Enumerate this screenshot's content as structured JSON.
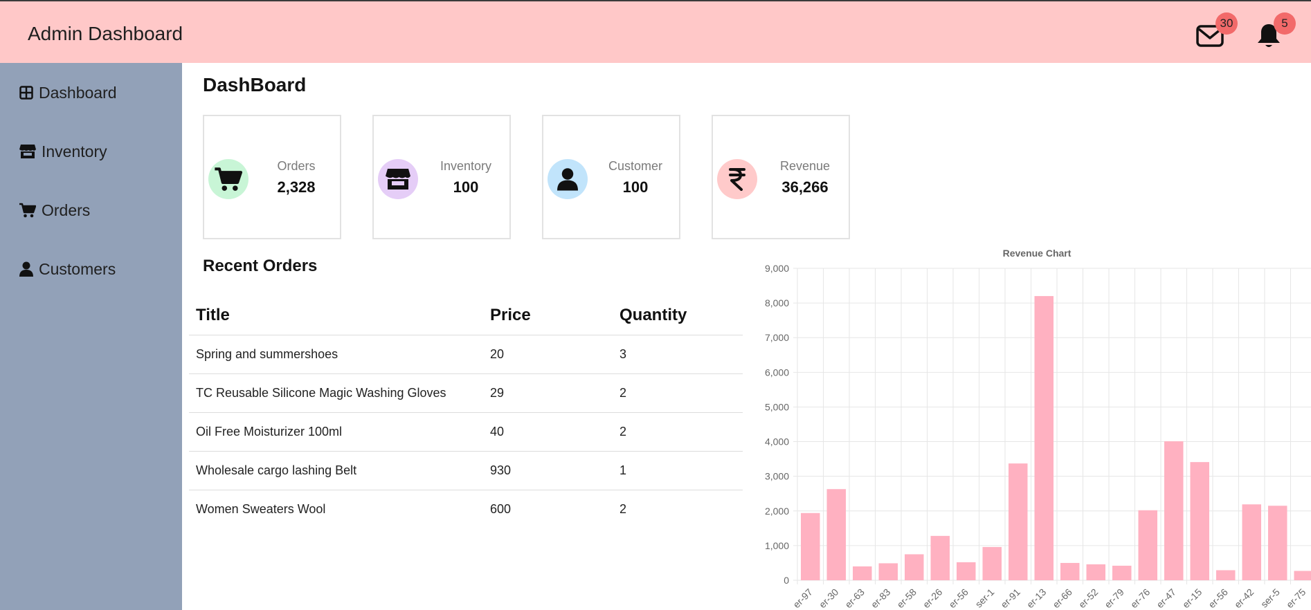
{
  "header": {
    "title": "Admin Dashboard",
    "mail_icon": "mail-icon",
    "mail_count": "30",
    "bell_icon": "bell-icon",
    "notification_count": "5"
  },
  "sidebar": {
    "items": [
      {
        "label": "Dashboard",
        "icon": "grid-icon"
      },
      {
        "label": "Inventory",
        "icon": "shop-icon"
      },
      {
        "label": "Orders",
        "icon": "cart-icon"
      },
      {
        "label": "Customers",
        "icon": "user-icon"
      }
    ]
  },
  "main": {
    "title": "DashBoard",
    "cards": [
      {
        "label": "Orders",
        "value": "2,328",
        "icon": "cart-icon",
        "color": "#c8f5d6"
      },
      {
        "label": "Inventory",
        "value": "100",
        "icon": "shop-icon",
        "color": "#e5cdf7"
      },
      {
        "label": "Customer",
        "value": "100",
        "icon": "user-icon",
        "color": "#c1e4fb"
      },
      {
        "label": "Revenue",
        "value": "36,266",
        "icon": "rupee-icon",
        "color": "#ffcaca"
      }
    ],
    "recent_orders": {
      "title": "Recent Orders",
      "columns": [
        "Title",
        "Price",
        "Quantity"
      ],
      "rows": [
        [
          "Spring and summershoes",
          "20",
          "3"
        ],
        [
          "TC Reusable Silicone Magic Washing Gloves",
          "29",
          "2"
        ],
        [
          "Oil Free Moisturizer 100ml",
          "40",
          "2"
        ],
        [
          "Wholesale cargo lashing Belt",
          "930",
          "1"
        ],
        [
          "Women Sweaters Wool",
          "600",
          "2"
        ]
      ]
    }
  },
  "colors": {
    "header_bg": "#ffc8c8",
    "sidebar_bg": "#92a1b8",
    "badge": "#f26a6a",
    "bar_fill": "#ffb1c1"
  },
  "chart_data": {
    "type": "bar",
    "title": "Revenue Chart",
    "categories": [
      "er-97",
      "er-30",
      "er-63",
      "er-83",
      "er-58",
      "er-26",
      "er-56",
      "ser-1",
      "er-91",
      "er-13",
      "er-66",
      "er-52",
      "er-79",
      "er-76",
      "er-47",
      "er-15",
      "er-56",
      "er-42",
      "ser-5",
      "er-75"
    ],
    "values": [
      1940,
      2630,
      400,
      490,
      750,
      1280,
      520,
      960,
      3370,
      8200,
      500,
      460,
      420,
      2020,
      4010,
      3410,
      290,
      2190,
      2150,
      270
    ],
    "ylim": [
      0,
      9000
    ],
    "yticks": [
      "0",
      "1,000",
      "2,000",
      "3,000",
      "4,000",
      "5,000",
      "6,000",
      "7,000",
      "8,000",
      "9,000"
    ],
    "grid": true,
    "legend": "none"
  }
}
